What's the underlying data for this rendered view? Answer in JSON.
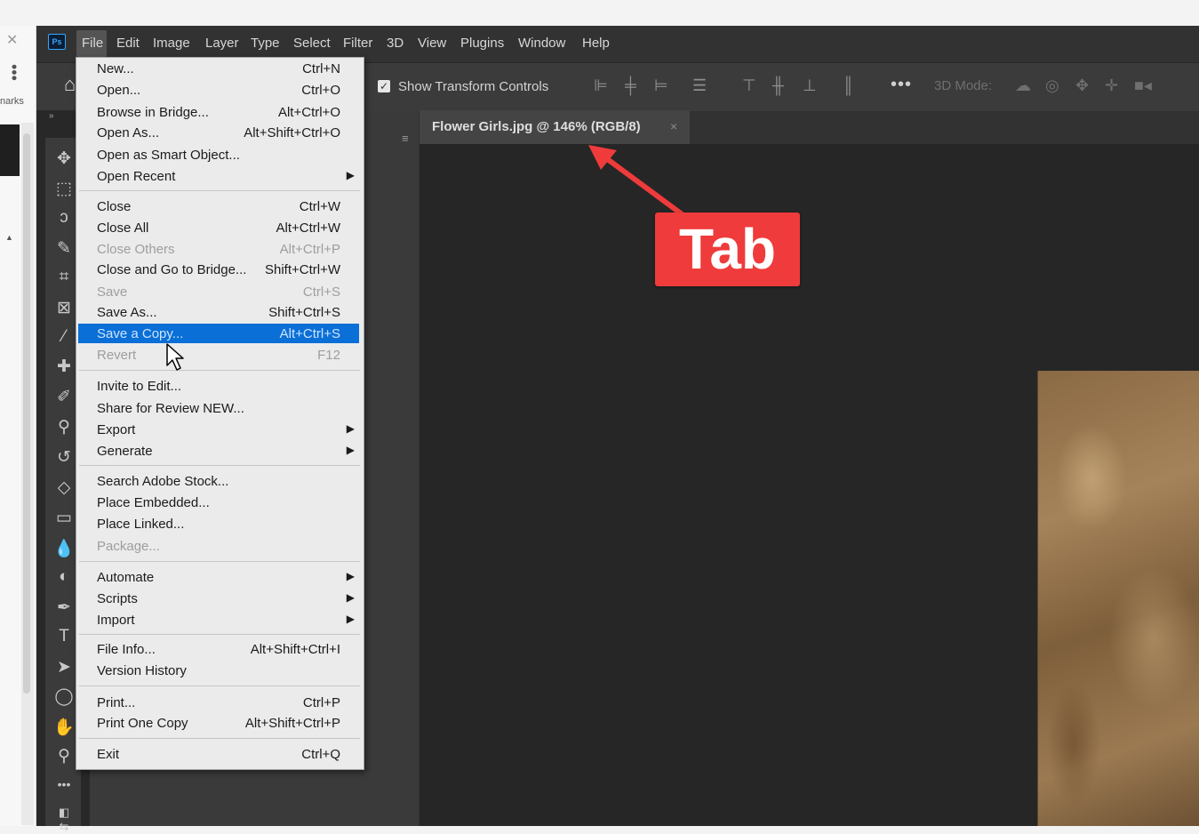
{
  "browser": {
    "bookmarks_partial": "narks"
  },
  "app": {
    "logo": "Ps",
    "menubar": [
      "File",
      "Edit",
      "Image",
      "Layer",
      "Type",
      "Select",
      "Filter",
      "3D",
      "View",
      "Plugins",
      "Window",
      "Help"
    ],
    "active_menu": "File"
  },
  "options": {
    "show_transform_controls": "Show Transform Controls",
    "checked": true,
    "more": "•••",
    "mode_3d": "3D Mode:"
  },
  "document": {
    "tab_title": "Flower Girls.jpg @ 146% (RGB/8)",
    "tab_close": "×"
  },
  "annotation": {
    "label": "Tab",
    "color": "#ef3b3b"
  },
  "file_menu": {
    "items": [
      {
        "label": "New...",
        "shortcut": "Ctrl+N"
      },
      {
        "label": "Open...",
        "shortcut": "Ctrl+O"
      },
      {
        "label": "Browse in Bridge...",
        "shortcut": "Alt+Ctrl+O"
      },
      {
        "label": "Open As...",
        "shortcut": "Alt+Shift+Ctrl+O"
      },
      {
        "label": "Open as Smart Object...",
        "shortcut": ""
      },
      {
        "label": "Open Recent",
        "shortcut": "",
        "submenu": true
      },
      {
        "label": "Close",
        "shortcut": "Ctrl+W"
      },
      {
        "label": "Close All",
        "shortcut": "Alt+Ctrl+W"
      },
      {
        "label": "Close Others",
        "shortcut": "Alt+Ctrl+P",
        "disabled": true
      },
      {
        "label": "Close and Go to Bridge...",
        "shortcut": "Shift+Ctrl+W"
      },
      {
        "label": "Save",
        "shortcut": "Ctrl+S",
        "disabled": true
      },
      {
        "label": "Save As...",
        "shortcut": "Shift+Ctrl+S"
      },
      {
        "label": "Save a Copy...",
        "shortcut": "Alt+Ctrl+S",
        "highlighted": true
      },
      {
        "label": "Revert",
        "shortcut": "F12",
        "disabled": true
      },
      {
        "label": "Invite to Edit...",
        "shortcut": ""
      },
      {
        "label": "Share for Review NEW...",
        "shortcut": ""
      },
      {
        "label": "Export",
        "shortcut": "",
        "submenu": true
      },
      {
        "label": "Generate",
        "shortcut": "",
        "submenu": true
      },
      {
        "label": "Search Adobe Stock...",
        "shortcut": ""
      },
      {
        "label": "Place Embedded...",
        "shortcut": ""
      },
      {
        "label": "Place Linked...",
        "shortcut": ""
      },
      {
        "label": "Package...",
        "shortcut": "",
        "disabled": true
      },
      {
        "label": "Automate",
        "shortcut": "",
        "submenu": true
      },
      {
        "label": "Scripts",
        "shortcut": "",
        "submenu": true
      },
      {
        "label": "Import",
        "shortcut": "",
        "submenu": true
      },
      {
        "label": "File Info...",
        "shortcut": "Alt+Shift+Ctrl+I"
      },
      {
        "label": "Version History",
        "shortcut": ""
      },
      {
        "label": "Print...",
        "shortcut": "Ctrl+P"
      },
      {
        "label": "Print One Copy",
        "shortcut": "Alt+Shift+Ctrl+P"
      },
      {
        "label": "Exit",
        "shortcut": "Ctrl+Q"
      }
    ]
  },
  "tools": [
    "move-tool-icon",
    "marquee-tool-icon",
    "lasso-tool-icon",
    "quick-selection-tool-icon",
    "crop-tool-icon",
    "frame-tool-icon",
    "eyedropper-tool-icon",
    "healing-tool-icon",
    "brush-tool-icon",
    "clone-stamp-tool-icon",
    "history-brush-tool-icon",
    "eraser-tool-icon",
    "gradient-tool-icon",
    "blur-tool-icon",
    "dodge-tool-icon",
    "pen-tool-icon",
    "type-tool-icon",
    "path-selection-tool-icon",
    "shape-tool-icon",
    "hand-tool-icon",
    "zoom-tool-icon",
    "more-tools-icon"
  ]
}
